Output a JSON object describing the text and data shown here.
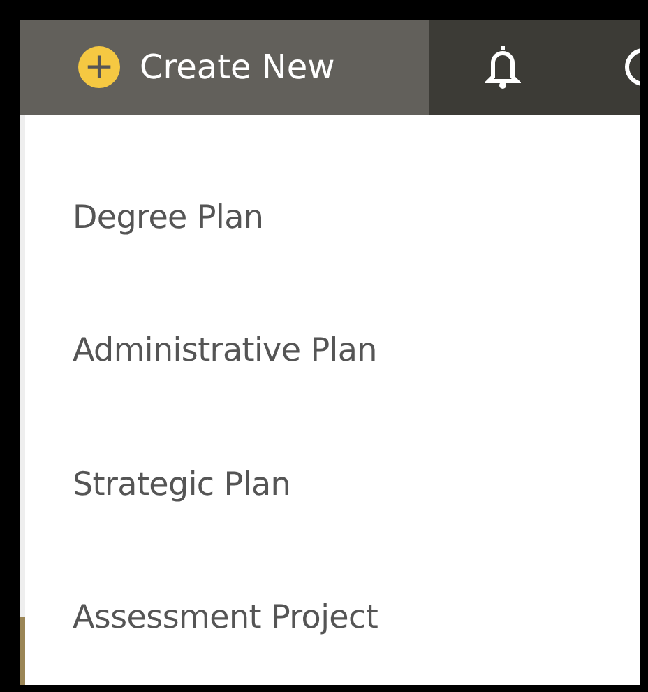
{
  "toolbar": {
    "create_button": {
      "icon": "+",
      "label": "Create New",
      "expanded": true
    }
  },
  "menu": {
    "items": [
      {
        "label": "Degree Plan"
      },
      {
        "label": "Administrative Plan"
      },
      {
        "label": "Strategic Plan"
      },
      {
        "label": "Assessment Project"
      }
    ]
  }
}
